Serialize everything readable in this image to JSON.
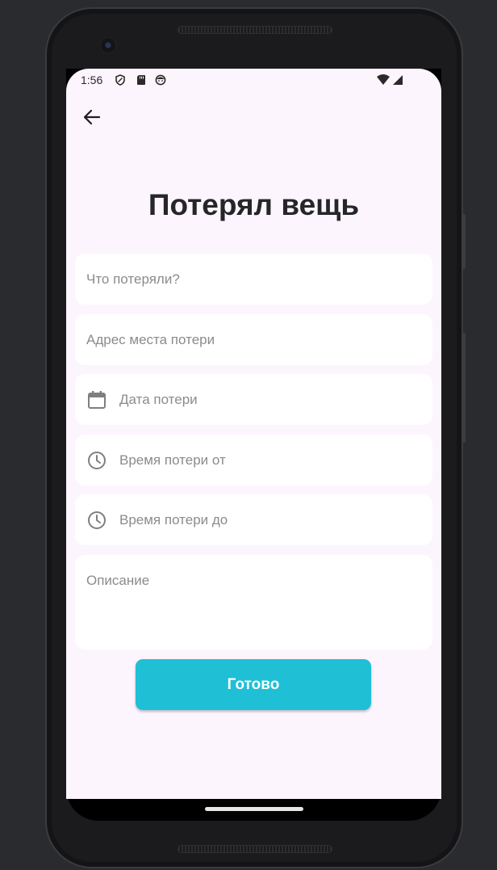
{
  "status_bar": {
    "time": "1:56",
    "icons_left": [
      "shield-icon",
      "sd-card-icon",
      "face-icon"
    ],
    "icons_right": [
      "wifi-icon",
      "signal-icon"
    ]
  },
  "header": {
    "back_icon": "arrow-back-icon"
  },
  "page": {
    "title": "Потерял вещь"
  },
  "form": {
    "item_placeholder": "Что потеряли?",
    "address_placeholder": "Адрес места потери",
    "date_placeholder": "Дата потери",
    "time_from_placeholder": "Время потери от",
    "time_to_placeholder": "Время потери до",
    "description_placeholder": "Описание",
    "submit_label": "Готово"
  },
  "colors": {
    "background": "#fdf5fd",
    "field": "#ffffff",
    "accent": "#1fbfd6",
    "title": "#262628",
    "placeholder": "#8c8a8e"
  }
}
